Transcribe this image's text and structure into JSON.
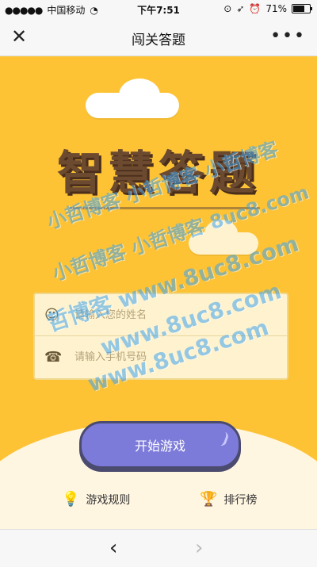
{
  "status_bar": {
    "carrier": "中国移动",
    "time": "下午7:51",
    "battery_percent": "71%",
    "battery_level": 0.71
  },
  "navbar": {
    "title": "闯关答题",
    "close_icon": "close-icon",
    "more_icon": "more-icon"
  },
  "hero": {
    "title": "智慧答题"
  },
  "form": {
    "name_placeholder": "请输入您的姓名",
    "phone_placeholder": "请输入手机号码",
    "name_icon": "user-icon",
    "phone_icon": "phone-icon"
  },
  "actions": {
    "start_label": "开始游戏",
    "rules_label": "游戏规则",
    "rank_label": "排行榜"
  },
  "watermark": {
    "lines": [
      "小哲博客 小哲博客 小哲博客",
      "小哲博客 小哲博客 8uc8.com",
      "哲博客 www.8uc8.com",
      "www.8uc8.com",
      "www.8uc8.com"
    ]
  },
  "colors": {
    "background": "#fdc335",
    "title": "#6b4a2f",
    "button": "#7d7bd9",
    "watermark": "#3da4f0"
  }
}
